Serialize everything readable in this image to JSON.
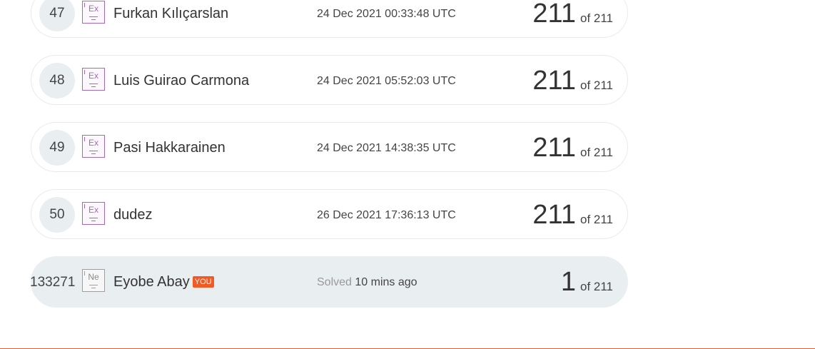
{
  "rows": [
    {
      "rank": "47",
      "element": "Ex",
      "name": "Furkan Kılıçarslan",
      "date": "24 Dec 2021 00:33:48 UTC",
      "score": "211",
      "total": "of 211"
    },
    {
      "rank": "48",
      "element": "Ex",
      "name": "Luis Guirao Carmona",
      "date": "24 Dec 2021 05:52:03 UTC",
      "score": "211",
      "total": "of 211"
    },
    {
      "rank": "49",
      "element": "Ex",
      "name": "Pasi Hakkarainen",
      "date": "24 Dec 2021 14:38:35 UTC",
      "score": "211",
      "total": "of 211"
    },
    {
      "rank": "50",
      "element": "Ex",
      "name": "dudez",
      "date": "26 Dec 2021 17:36:13 UTC",
      "score": "211",
      "total": "of 211"
    }
  ],
  "you_row": {
    "rank": "133271",
    "element": "Ne",
    "name": "Eyobe Abay",
    "tag": "YOU",
    "solved_label": "Solved",
    "solved_time": "10 mins ago",
    "score": "1",
    "total": "of 211"
  },
  "colors": {
    "accent": "#f15a24",
    "badge_purple": "#a56ab6",
    "highlight_row": "#e9eff1"
  }
}
